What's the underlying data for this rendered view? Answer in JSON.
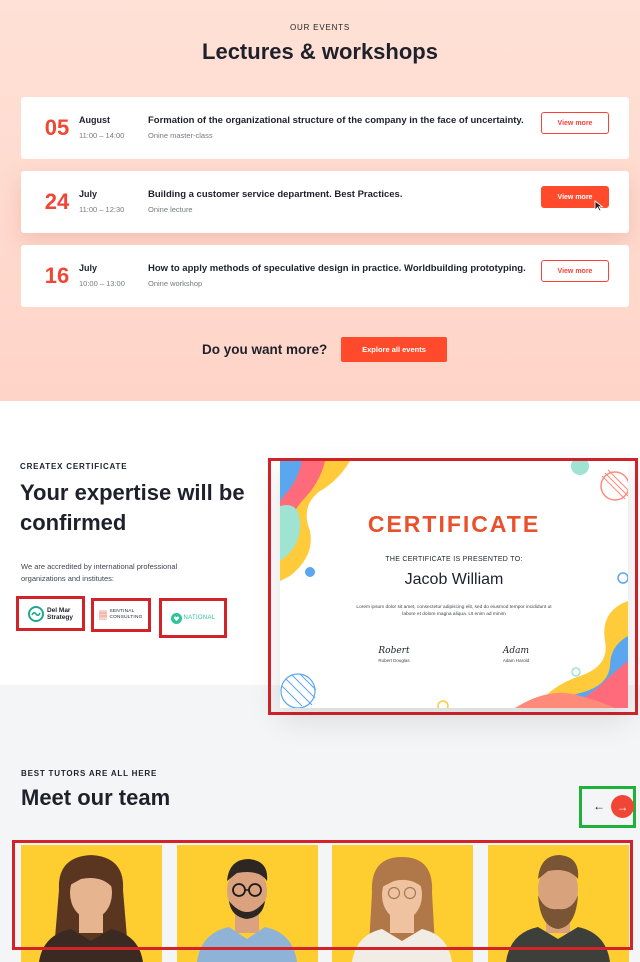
{
  "events": {
    "eyebrow": "OUR EVENTS",
    "heading": "Lectures & workshops",
    "items": [
      {
        "day": "05",
        "month": "August",
        "time": "11:00 – 14:00",
        "title": "Formation of the organizational structure of the company in the face of uncertainty.",
        "type": "Onine master-class",
        "button": "View more",
        "active": false
      },
      {
        "day": "24",
        "month": "July",
        "time": "11:00 – 12:30",
        "title": "Building a customer service department. Best Practices.",
        "type": "Onine lecture",
        "button": "View more",
        "active": true
      },
      {
        "day": "16",
        "month": "July",
        "time": "10:00 – 13:00",
        "title": "How to apply methods of speculative design in practice. Worldbuilding prototyping.",
        "type": "Onine workshop",
        "button": "View more",
        "active": false
      }
    ],
    "more_text": "Do you want more?",
    "explore_button": "Explore all events"
  },
  "certificate": {
    "eyebrow": "CREATEX CERTIFICATE",
    "heading": "Your expertise will be confirmed",
    "text": "We are accredited by international professional organizations and institutes:",
    "logos": [
      {
        "name": "Del Mar Strategy",
        "line1": "Del Mar",
        "line2": "Strategy"
      },
      {
        "name": "Sentinal Consulting",
        "line1": "SENTINAL",
        "line2": "CONSULTING"
      },
      {
        "name": "National",
        "line1": "NATIONAL"
      }
    ],
    "card": {
      "title": "CERTIFICATE",
      "presented": "THE CERTIFICATE IS PRESENTED TO:",
      "name": "Jacob William",
      "lorem": "Lorem ipsum dolor sit amet, consectetur adipiscing elit, sed do eiusmod tempor incididunt ut labore et dolore magna aliqua. Ut enim ad minim",
      "signatures": [
        {
          "script": "Robert",
          "name": "Robert Douglas"
        },
        {
          "script": "Adam",
          "name": "Adam Harold"
        }
      ]
    }
  },
  "team": {
    "eyebrow": "BEST TUTORS ARE ALL HERE",
    "heading": "Meet our team",
    "prev_arrow": "←",
    "next_arrow": "→",
    "tutors": [
      {
        "hair": "#5a3620",
        "shirt": "#3a2a22",
        "skin": "#e6b48f",
        "long_hair": true
      },
      {
        "hair": "#2e2622",
        "shirt": "#8fb3d6",
        "skin": "#dba27f",
        "long_hair": false
      },
      {
        "hair": "#b07848",
        "shirt": "#f2ede4",
        "skin": "#efc39f",
        "long_hair": true
      },
      {
        "hair": "#7a5535",
        "shirt": "#3d3f3a",
        "skin": "#d8a27c",
        "long_hair": false
      }
    ]
  },
  "colors": {
    "accent": "#ff4b2b",
    "highlight_red": "#d3232a",
    "highlight_green": "#1fb23a",
    "tutor_bg": "#fecd2f"
  }
}
